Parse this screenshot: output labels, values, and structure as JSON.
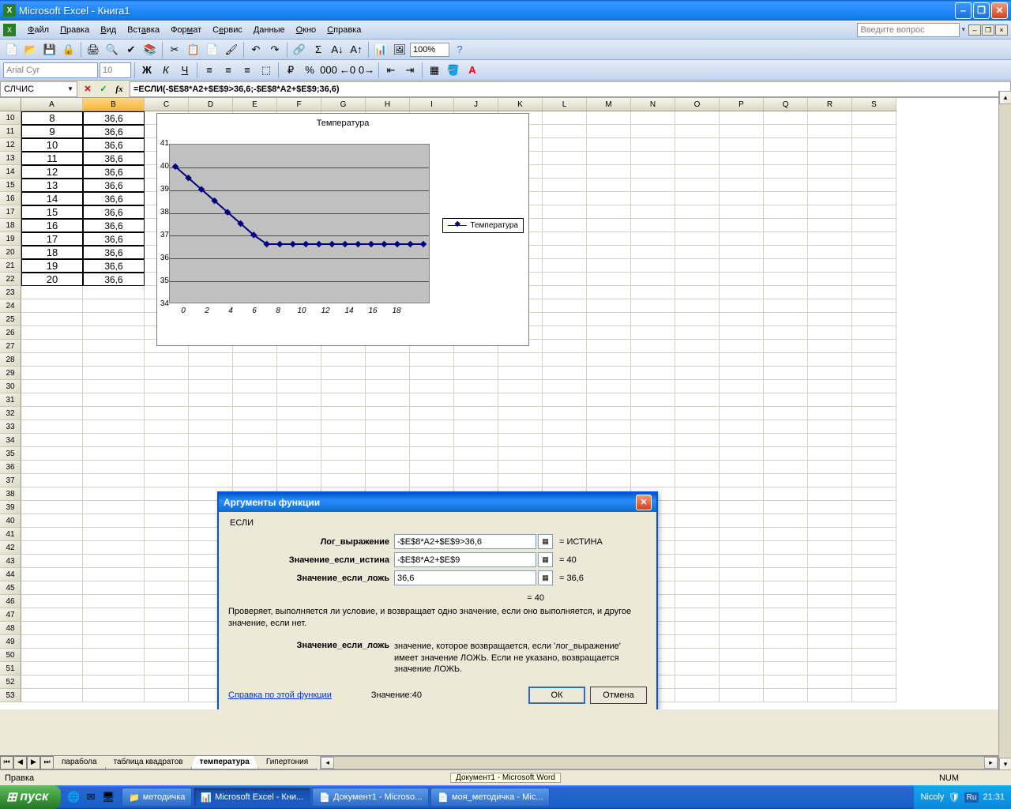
{
  "titlebar": {
    "text": "Microsoft Excel - Книга1"
  },
  "menu": {
    "file": "Файл",
    "edit": "Правка",
    "view": "Вид",
    "insert": "Вставка",
    "format": "Формат",
    "tools": "Сервис",
    "data": "Данные",
    "window": "Окно",
    "help": "Справка",
    "help_placeholder": "Введите вопрос"
  },
  "toolbar": {
    "font_name": "Arial Cyr",
    "font_size": "10",
    "zoom": "100%"
  },
  "formulabar": {
    "namebox": "СЛЧИС",
    "formula": "=ЕСЛИ(-$E$8*A2+$E$9>36,6;-$E$8*A2+$E$9;36,6)"
  },
  "colheaders": [
    "A",
    "B",
    "C",
    "D",
    "E",
    "F",
    "G",
    "H",
    "I",
    "J",
    "K",
    "L",
    "M",
    "N",
    "O",
    "P",
    "Q",
    "R",
    "S"
  ],
  "rowheaders_start": 10,
  "rowheaders_count": 44,
  "data_rows": [
    {
      "a": "8",
      "b": "36,6"
    },
    {
      "a": "9",
      "b": "36,6"
    },
    {
      "a": "10",
      "b": "36,6"
    },
    {
      "a": "11",
      "b": "36,6"
    },
    {
      "a": "12",
      "b": "36,6"
    },
    {
      "a": "13",
      "b": "36,6"
    },
    {
      "a": "14",
      "b": "36,6"
    },
    {
      "a": "15",
      "b": "36,6"
    },
    {
      "a": "16",
      "b": "36,6"
    },
    {
      "a": "17",
      "b": "36,6"
    },
    {
      "a": "18",
      "b": "36,6"
    },
    {
      "a": "19",
      "b": "36,6"
    },
    {
      "a": "20",
      "b": "36,6"
    }
  ],
  "chart_data": {
    "type": "line",
    "title": "Температура",
    "legend": "Температура",
    "xlabel": "",
    "ylabel": "",
    "ylim": [
      34,
      41
    ],
    "yticks": [
      34,
      35,
      36,
      37,
      38,
      39,
      40,
      41
    ],
    "x": [
      0,
      1,
      2,
      3,
      4,
      5,
      6,
      7,
      8,
      9,
      10,
      11,
      12,
      13,
      14,
      15,
      16,
      17,
      18,
      19
    ],
    "y": [
      40.0,
      39.5,
      39.0,
      38.5,
      38.0,
      37.5,
      37.0,
      36.6,
      36.6,
      36.6,
      36.6,
      36.6,
      36.6,
      36.6,
      36.6,
      36.6,
      36.6,
      36.6,
      36.6,
      36.6
    ],
    "xticks": [
      0,
      2,
      4,
      6,
      8,
      10,
      12,
      14,
      16,
      18
    ]
  },
  "dialog": {
    "title": "Аргументы функции",
    "func_name": "ЕСЛИ",
    "arg1_label": "Лог_выражение",
    "arg1_val": "-$E$8*A2+$E$9>36,6",
    "arg1_res": "= ИСТИНА",
    "arg2_label": "Значение_если_истина",
    "arg2_val": "-$E$8*A2+$E$9",
    "arg2_res": "= 40",
    "arg3_label": "Значение_если_ложь",
    "arg3_val": "36,6",
    "arg3_res": "= 36,6",
    "result_line": "= 40",
    "desc": "Проверяет, выполняется ли условие, и возвращает одно значение, если оно выполняется, и другое значение, если нет.",
    "d2_label": "Значение_если_ложь",
    "d2_text": "значение, которое возвращается, если 'лог_выражение' имеет значение ЛОЖЬ. Если не указано, возвращается значение ЛОЖЬ.",
    "help_link": "Справка по этой функции",
    "value_label": "Значение:",
    "value_val": "40",
    "ok": "ОК",
    "cancel": "Отмена"
  },
  "sheets": {
    "s1": "парабола",
    "s2": "таблица квадратов",
    "s3": "температура",
    "s4": "Гипертония"
  },
  "statusbar": {
    "left": "Правка",
    "num": "NUM",
    "doc_hint": "Документ1 - Microsoft Word"
  },
  "taskbar": {
    "start": "пуск",
    "t1": "методичка",
    "t2": "Microsoft Excel - Кни...",
    "t3": "Документ1 - Microso...",
    "t4": "моя_методичка - Mic...",
    "tray_user": "Nicoly",
    "lang": "Ru",
    "time": "21:31"
  }
}
